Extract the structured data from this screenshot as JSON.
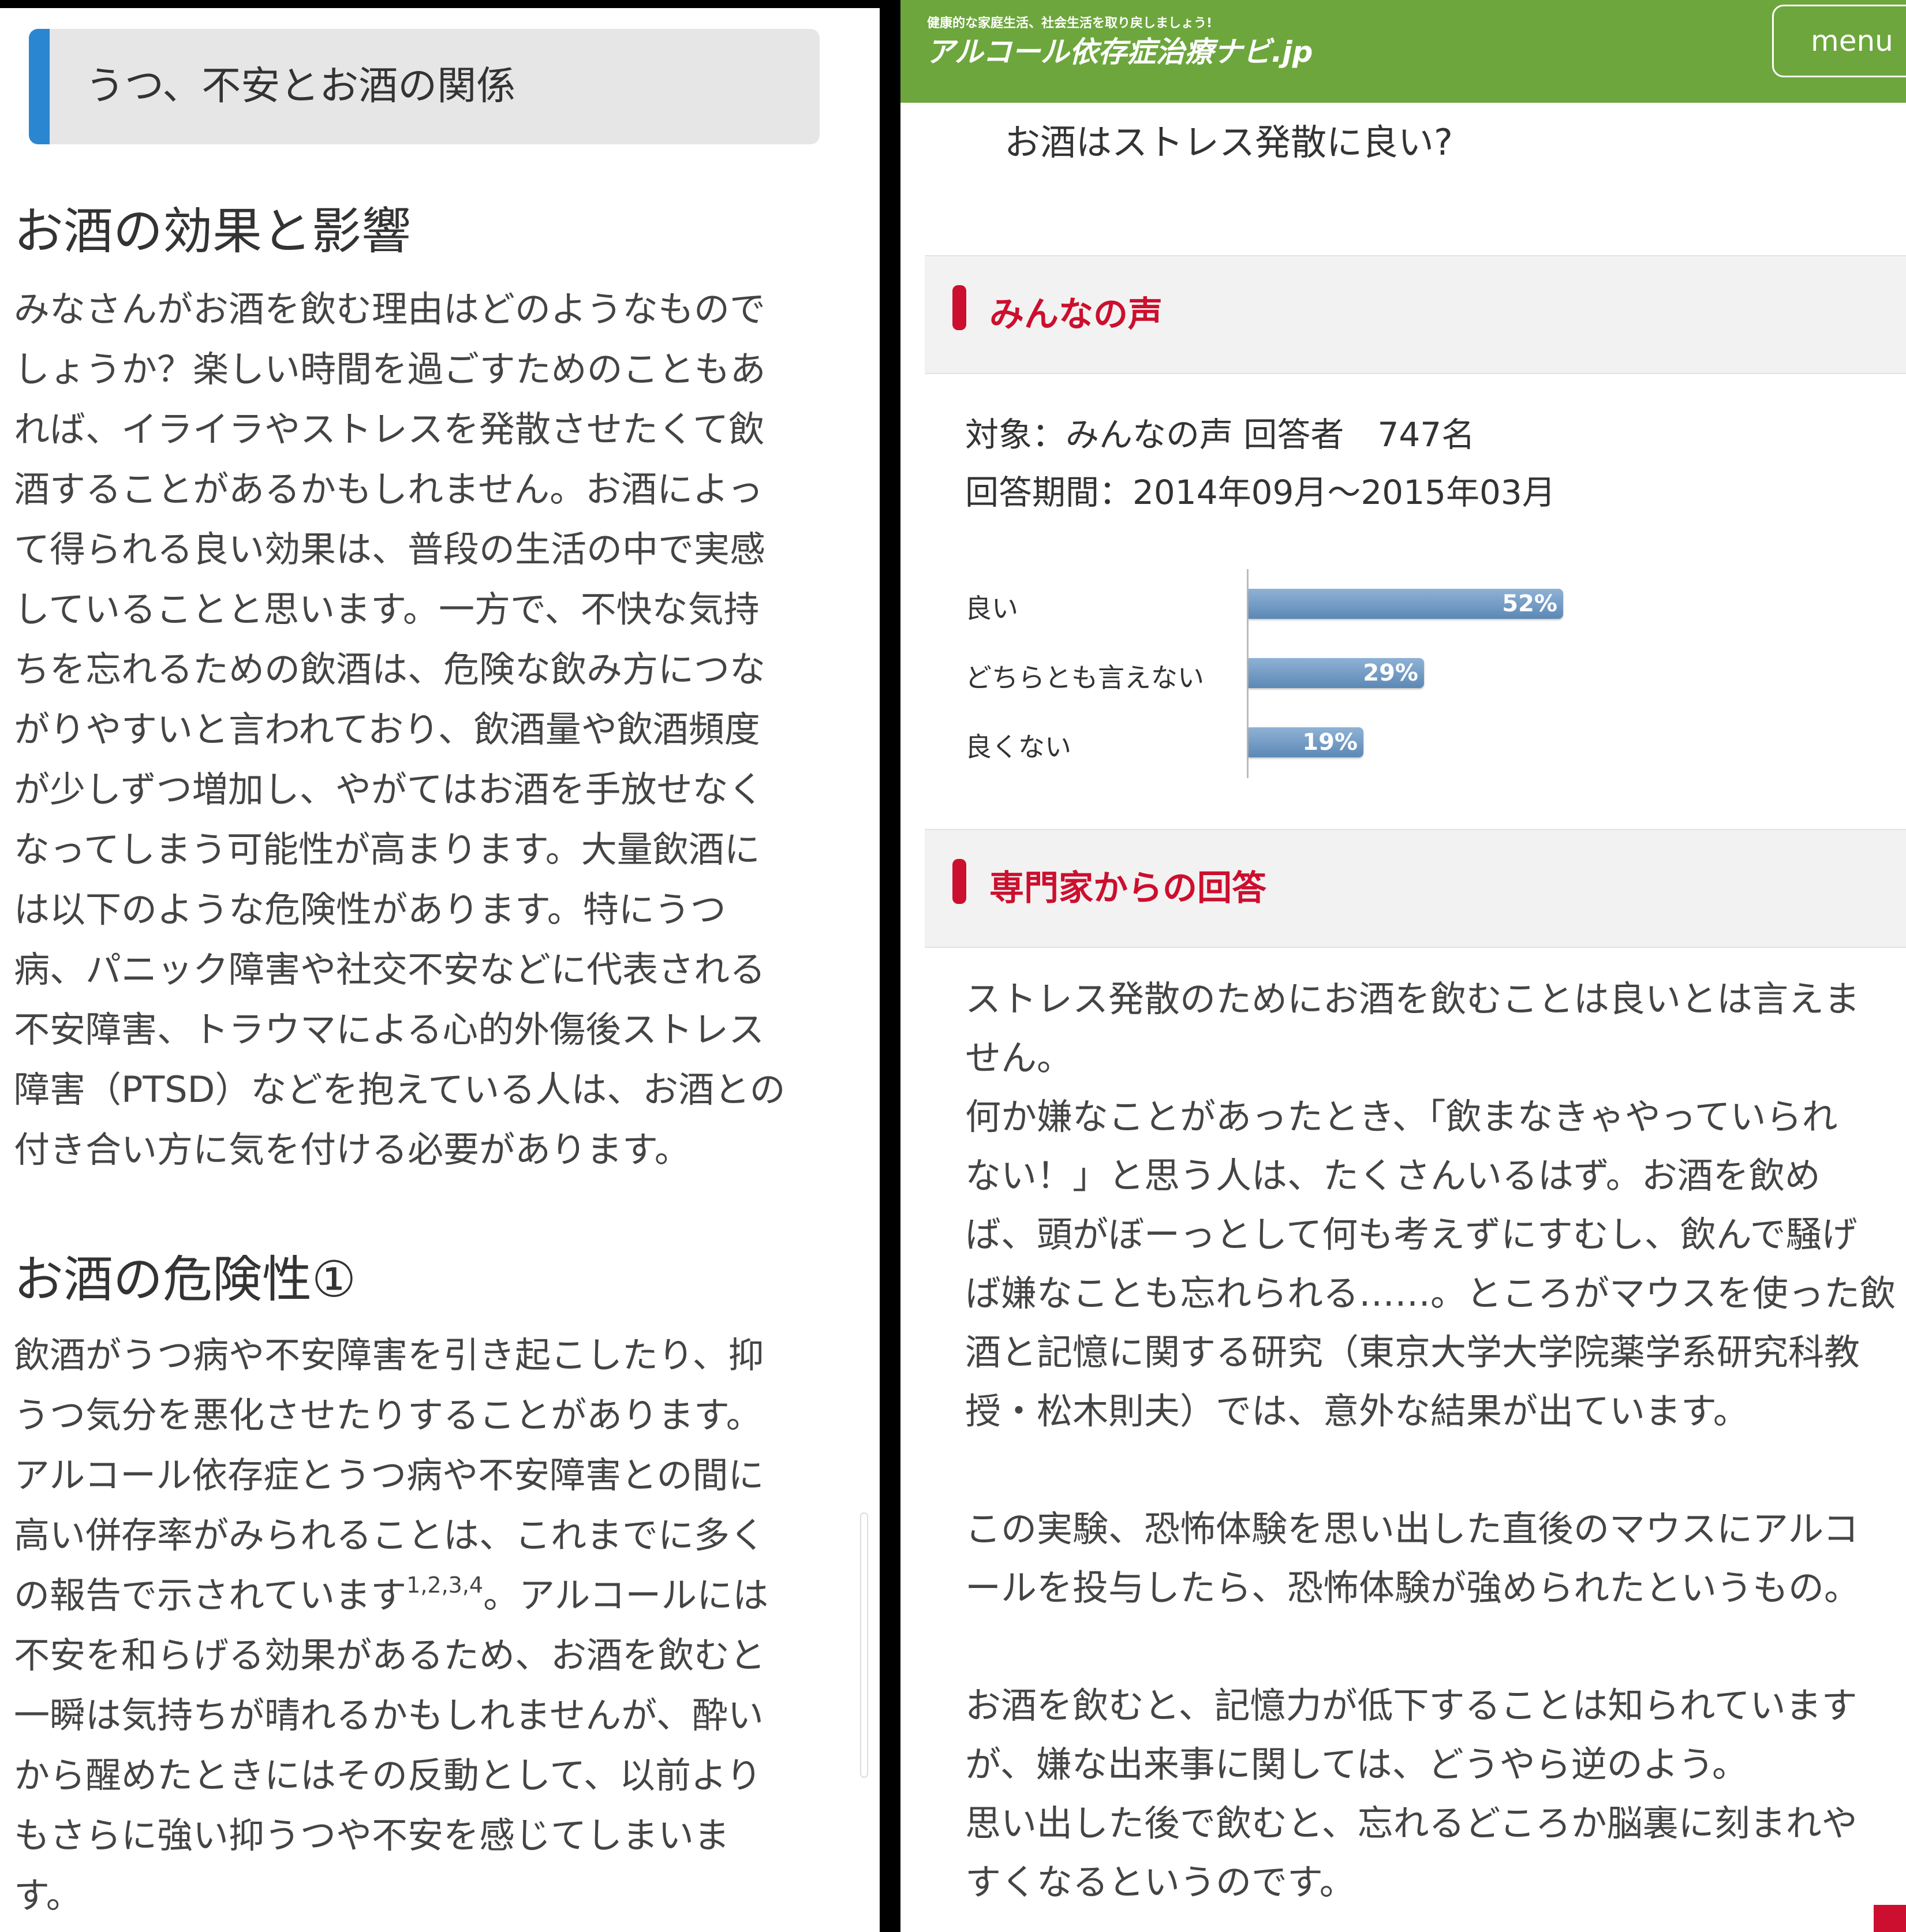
{
  "left_panel": {
    "section_title": "うつ、不安とお酒の関係",
    "heading1": "お酒の効果と影響",
    "para1": [
      "みなさんがお酒を飲む理由はどのようなもので",
      "しょうか？楽しい時間を過ごすためのこともあ",
      "れば、イライラやストレスを発散させたくて飲",
      "酒することがあるかもしれません。お酒によっ",
      "て得られる良い効果は、普段の生活の中で実感",
      "していることと思います。一方で、不快な気持",
      "ちを忘れるための飲酒は、危険な飲み方につな",
      "がりやすいと言われており、飲酒量や飲酒頻度",
      "が少しずつ増加し、やがてはお酒を手放せなく",
      "なってしまう可能性が高まります。大量飲酒に",
      "は以下のような危険性があります。特にうつ",
      "病、パニック障害や社交不安などに代表される",
      "不安障害、トラウマによる心的外傷後ストレス",
      "障害（PTSD）などを抱えている人は、お酒との",
      "付き合い方に気を付ける必要があります。"
    ],
    "heading2": "お酒の危険性①",
    "para2": {
      "lines_before": [
        "飲酒がうつ病や不安障害を引き起こしたり、抑",
        "うつ気分を悪化させたりすることがあります。",
        "アルコール依存症とうつ病や不安障害との間に",
        "高い併存率がみられることは、これまでに多く"
      ],
      "line5_start": "の報告で示されています",
      "line5_sup": "1,2,3,4",
      "line5_end": "。アルコールには",
      "lines_after": [
        "不安を和らげる効果があるため、お酒を飲むと",
        "一瞬は気持ちが晴れるかもしれませんが、酔い",
        "から醒めたときにはその反動として、以前より",
        "もさらに強い抑うつや不安を感じてしまいま",
        "す。"
      ]
    }
  },
  "right_panel": {
    "header": {
      "tagline": "健康的な家庭生活、社会生活を取り戻しましょう!",
      "site_name": "アルコール依存症治療ナビ.jp",
      "menu_label": "menu"
    },
    "question": "お酒はストレス発散に良い?",
    "voices_title": "みんなの声",
    "survey_target": "対象：みんなの声 回答者　747名",
    "survey_period": "回答期間：2014年09月〜2015年03月",
    "expert_title": "専門家からの回答",
    "expert_text": [
      "ストレス発散のためにお酒を飲むことは良いとは言えま",
      "せん。",
      "何か嫌なことがあったとき、「飲まなきゃやっていられ",
      "ない！」と思う人は、たくさんいるはず。お酒を飲め",
      "ば、頭がぼーっとして何も考えずにすむし、飲んで騒げ",
      "ば嫌なことも忘れられる……。ところがマウスを使った飲",
      "酒と記憶に関する研究（東京大学大学院薬学系研究科教",
      "授・松木則夫）では、意外な結果が出ています。",
      "",
      "この実験、恐怖体験を思い出した直後のマウスにアルコ",
      "ールを投与したら、恐怖体験が強められたというもの。",
      "",
      "お酒を飲むと、記憶力が低下することは知られています",
      "が、嫌な出来事に関しては、どうやら逆のよう。",
      "思い出した後で飲むと、忘れるどころか脳裏に刻まれや",
      "すくなるというのです。"
    ],
    "colors": {
      "header_green": "#6da63d",
      "accent_red": "#cc0f2e",
      "bar_blue": "#5c88b5",
      "left_accent_blue": "#2a86d1"
    }
  },
  "chart_data": {
    "type": "bar",
    "orientation": "horizontal",
    "categories": [
      "良い",
      "どちらとも言えない",
      "良くない"
    ],
    "values": [
      52,
      29,
      19
    ],
    "value_labels": [
      "52%",
      "29%",
      "19%"
    ],
    "xlim": [
      0,
      100
    ]
  }
}
